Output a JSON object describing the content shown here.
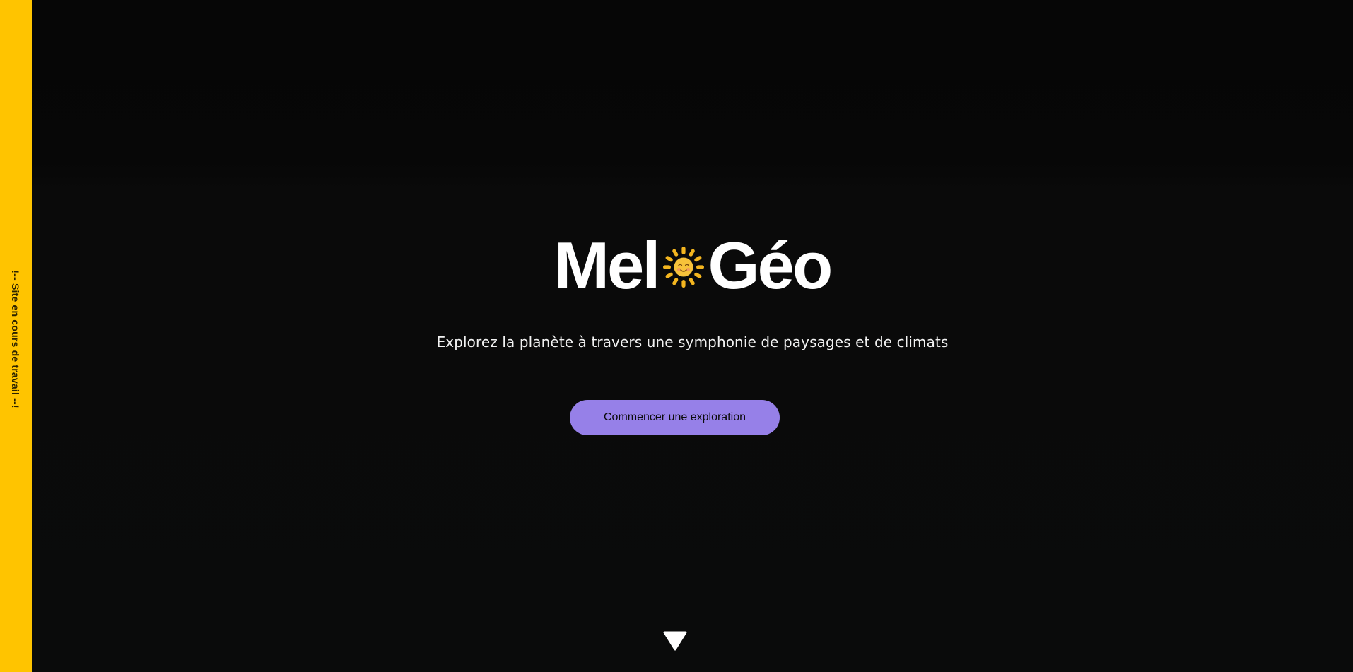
{
  "sidebar": {
    "label": "!-- Site en cours de travail --!"
  },
  "hero": {
    "logo_left": "Mel",
    "logo_icon": "smiling-sun-icon",
    "logo_right": "Géo",
    "subtitle": "Explorez la planète à travers une symphonie de paysages et de climats",
    "cta_label": "Commencer une exploration",
    "scroll_icon": "triangle-down-icon"
  },
  "colors": {
    "sidebar_bg": "#ffc400",
    "page_bg": "#090909",
    "cta_bg": "#9680e8",
    "sun_yellow": "#f3b51f",
    "text": "#ffffff"
  }
}
